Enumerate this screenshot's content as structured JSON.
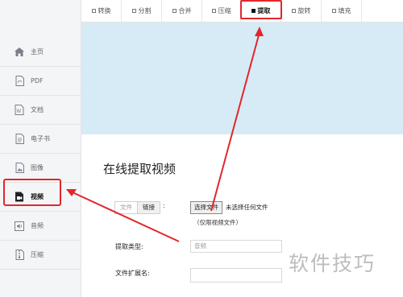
{
  "tabs": [
    {
      "label": "转换",
      "active": false
    },
    {
      "label": "分割",
      "active": false
    },
    {
      "label": "合并",
      "active": false
    },
    {
      "label": "压缩",
      "active": false
    },
    {
      "label": "提取",
      "active": true
    },
    {
      "label": "旋转",
      "active": false
    },
    {
      "label": "填充",
      "active": false
    }
  ],
  "sidebar": {
    "items": [
      {
        "label": "主页",
        "icon": "home-icon"
      },
      {
        "label": "PDF",
        "icon": "pdf-icon"
      },
      {
        "label": "文档",
        "icon": "word-icon"
      },
      {
        "label": "电子书",
        "icon": "ebook-icon"
      },
      {
        "label": "图像",
        "icon": "image-icon"
      },
      {
        "label": "视频",
        "icon": "video-icon",
        "active": true
      },
      {
        "label": "音频",
        "icon": "audio-icon"
      },
      {
        "label": "压缩",
        "icon": "archive-icon"
      }
    ]
  },
  "main": {
    "title": "在线提取视频",
    "source_toggle": {
      "file_label": "文件",
      "link_label": "链接",
      "colon": ":"
    },
    "file_picker": {
      "button_label": "选择文件",
      "status": "未选择任何文件"
    },
    "hint": "（仅限视频文件）",
    "extract_type": {
      "label": "提取类型:",
      "value": "音频"
    },
    "file_ext": {
      "label": "文件扩展名:",
      "value": ""
    }
  },
  "watermark": "软件技巧",
  "colors": {
    "highlight": "#e2262b",
    "banner": "#d6ebf6",
    "sidebar": "#f4f5f7"
  }
}
